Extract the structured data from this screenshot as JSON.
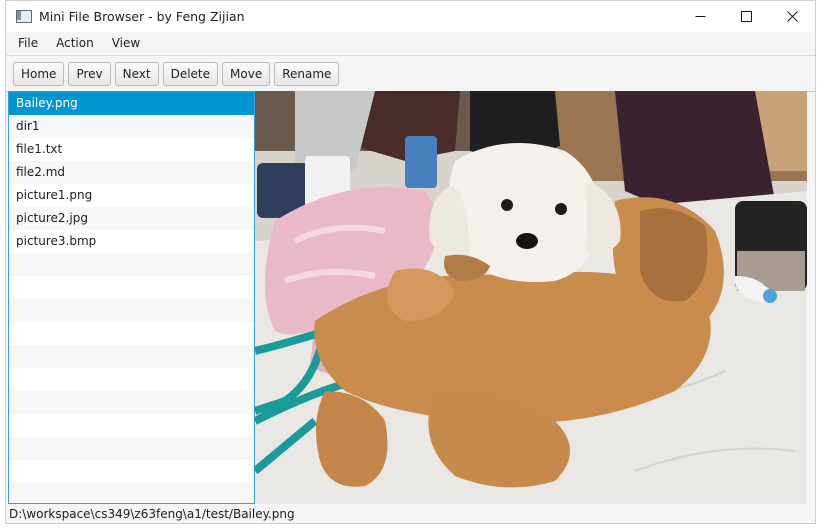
{
  "window": {
    "title": "Mini File Browser - by Feng Zijian",
    "icon": "app-window-icon",
    "controls": [
      "minimize-icon",
      "maximize-icon",
      "close-icon"
    ]
  },
  "menu": {
    "items": [
      {
        "label": "File"
      },
      {
        "label": "Action"
      },
      {
        "label": "View"
      }
    ]
  },
  "toolbar": {
    "buttons": [
      {
        "label": "Home"
      },
      {
        "label": "Prev"
      },
      {
        "label": "Next"
      },
      {
        "label": "Delete"
      },
      {
        "label": "Move"
      },
      {
        "label": "Rename"
      }
    ]
  },
  "file_list": {
    "selected_index": 0,
    "items": [
      {
        "label": "Bailey.png"
      },
      {
        "label": "dir1"
      },
      {
        "label": "file1.txt"
      },
      {
        "label": "file2.md"
      },
      {
        "label": "picture1.png"
      },
      {
        "label": "picture2.jpg"
      },
      {
        "label": "picture3.bmp"
      }
    ],
    "selection_color": "#0496d3",
    "border_color": "#3d9bd7"
  },
  "preview": {
    "subject": "photo of a small white puppy lying on a tan plush toy dog on a marble table"
  },
  "status": {
    "path": "D:\\workspace\\cs349\\z63feng\\a1/test/Bailey.png"
  }
}
